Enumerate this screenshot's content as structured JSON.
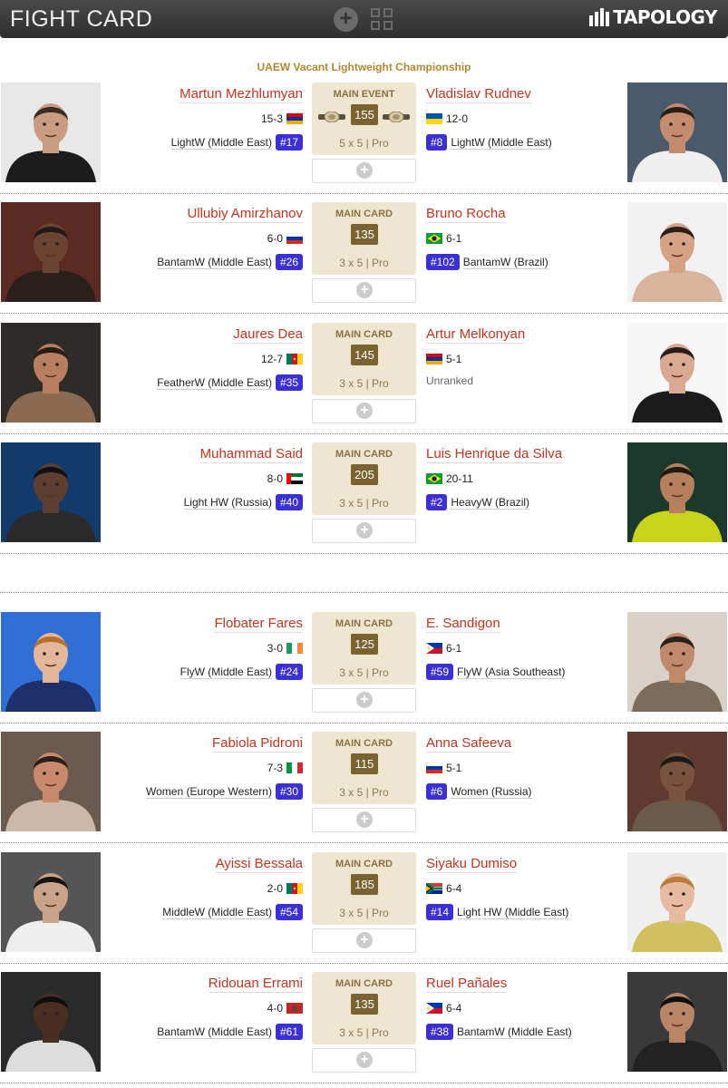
{
  "header": {
    "title": "FIGHT CARD",
    "logo_text": "TAPOLOGY",
    "add_icon": "plus-circle-icon",
    "grid_icon": "grid-view-icon"
  },
  "championship_title": "UAEW Vacant Lightweight Championship",
  "bouts": [
    {
      "label": "MAIN EVENT",
      "weight": "155",
      "rounds": "5 x 5  |  Pro",
      "belt": true,
      "left": {
        "name": "Martun Mezhlumyan",
        "record": "15-3",
        "flag": "armenia",
        "division": "LightW (Middle East)",
        "rank": "#17"
      },
      "right": {
        "name": "Vladislav Rudnev",
        "record": "12-0",
        "flag": "ukraine",
        "division": "LightW (Middle East)",
        "rank": "#8"
      }
    },
    {
      "label": "MAIN CARD",
      "weight": "135",
      "rounds": "3 x 5  |  Pro",
      "belt": false,
      "left": {
        "name": "Ullubiy Amirzhanov",
        "record": "6-0",
        "flag": "russia",
        "division": "BantamW (Middle East)",
        "rank": "#26"
      },
      "right": {
        "name": "Bruno Rocha",
        "record": "6-1",
        "flag": "brazil",
        "division": "BantamW (Brazil)",
        "rank": "#102"
      }
    },
    {
      "label": "MAIN CARD",
      "weight": "145",
      "rounds": "3 x 5  |  Pro",
      "belt": false,
      "left": {
        "name": "Jaures Dea",
        "record": "12-7",
        "flag": "cameroon",
        "division": "FeatherW (Middle East)",
        "rank": "#35"
      },
      "right": {
        "name": "Artur Melkonyan",
        "record": "5-1",
        "flag": "armenia",
        "division": "",
        "rank": "",
        "unranked": "Unranked"
      }
    },
    {
      "label": "MAIN CARD",
      "weight": "205",
      "rounds": "3 x 5  |  Pro",
      "belt": false,
      "left": {
        "name": "Muhammad Said",
        "record": "8-0",
        "flag": "uae",
        "division": "Light HW (Russia)",
        "rank": "#40"
      },
      "right": {
        "name": "Luis Henrique da Silva",
        "record": "20-11",
        "flag": "brazil",
        "division": "HeavyW (Brazil)",
        "rank": "#2"
      }
    },
    {
      "label": "MAIN CARD",
      "weight": "125",
      "rounds": "3 x 5  |  Pro",
      "belt": false,
      "left": {
        "name": "Flobater Fares",
        "record": "3-0",
        "flag": "ireland",
        "division": "FlyW (Middle East)",
        "rank": "#24"
      },
      "right": {
        "name": "E. Sandigon",
        "record": "6-1",
        "flag": "philippines",
        "division": "FlyW (Asia Southeast)",
        "rank": "#59"
      }
    },
    {
      "label": "MAIN CARD",
      "weight": "115",
      "rounds": "3 x 5  |  Pro",
      "belt": false,
      "left": {
        "name": "Fabiola Pidroni",
        "record": "7-3",
        "flag": "italy",
        "division": "Women (Europe Western)",
        "rank": "#30"
      },
      "right": {
        "name": "Anna Safeeva",
        "record": "5-1",
        "flag": "russia",
        "division": "Women (Russia)",
        "rank": "#6"
      }
    },
    {
      "label": "MAIN CARD",
      "weight": "185",
      "rounds": "3 x 5  |  Pro",
      "belt": false,
      "left": {
        "name": "Ayissi Bessala",
        "record": "2-0",
        "flag": "cameroon",
        "division": "MiddleW (Middle East)",
        "rank": "#54"
      },
      "right": {
        "name": "Siyaku Dumiso",
        "record": "6-4",
        "flag": "south-africa",
        "division": "Light HW (Middle East)",
        "rank": "#14"
      }
    },
    {
      "label": "MAIN CARD",
      "weight": "135",
      "rounds": "3 x 5  |  Pro",
      "belt": false,
      "left": {
        "name": "Ridouan Errami",
        "record": "4-0",
        "flag": "morocco",
        "division": "BantamW (Middle East)",
        "rank": "#61"
      },
      "right": {
        "name": "Ruel Pañales",
        "record": "6-4",
        "flag": "philippines",
        "division": "BantamW (Middle East)",
        "rank": "#38"
      }
    }
  ]
}
